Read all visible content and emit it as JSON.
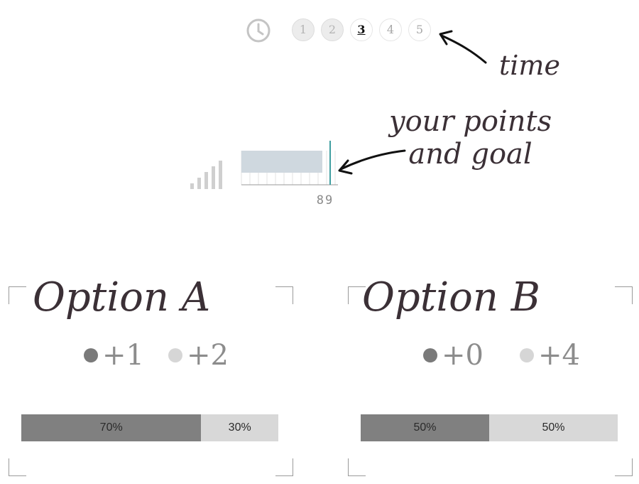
{
  "rounds": [
    {
      "label": "1",
      "state": "past"
    },
    {
      "label": "2",
      "state": "past"
    },
    {
      "label": "3",
      "state": "current"
    },
    {
      "label": "4",
      "state": "future"
    },
    {
      "label": "5",
      "state": "future"
    }
  ],
  "annotations": {
    "time": "time",
    "points_line1": "your points",
    "points_line2": "and goal"
  },
  "points": {
    "current_fraction": 0.84,
    "goal_label": "89"
  },
  "icons": {
    "timer": "clock-icon",
    "rank": "signal-bars-icon"
  },
  "options": [
    {
      "title": "Option A",
      "outcomes": [
        {
          "label": "+1",
          "color": "#7a7a7a"
        },
        {
          "label": "+2",
          "color": "#d6d6d6"
        }
      ],
      "probabilities": [
        {
          "label": "70%",
          "value": 0.7
        },
        {
          "label": "30%",
          "value": 0.3
        }
      ]
    },
    {
      "title": "Option B",
      "outcomes": [
        {
          "label": "+0",
          "color": "#7a7a7a"
        },
        {
          "label": "+4",
          "color": "#d6d6d6"
        }
      ],
      "probabilities": [
        {
          "label": "50%",
          "value": 0.5
        },
        {
          "label": "50%",
          "value": 0.5
        }
      ]
    }
  ],
  "colors": {
    "progress_fill": "#cfd8df",
    "goal_line": "#3f9ea0",
    "outcome_dark": "#808080",
    "outcome_light": "#d8d8d8"
  }
}
